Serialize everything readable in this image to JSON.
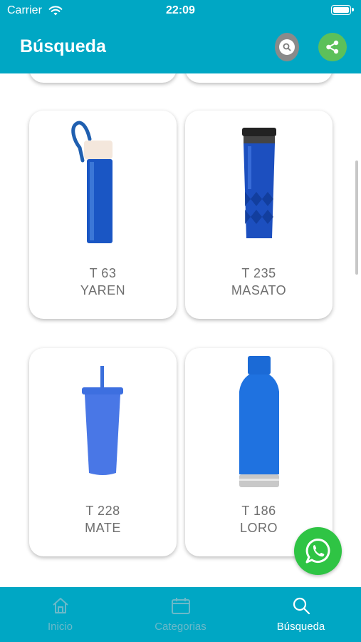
{
  "status_bar": {
    "carrier": "Carrier",
    "time": "22:09"
  },
  "header": {
    "title": "Búsqueda",
    "search_icon": "search-icon",
    "share_icon": "share-icon",
    "background": "#00a7c4"
  },
  "products": [
    {
      "code": "T 63",
      "name": "YAREN",
      "icon": "bottle-icon"
    },
    {
      "code": "T 235",
      "name": "MASATO",
      "icon": "tumbler-icon"
    },
    {
      "code": "T 228",
      "name": "MATE",
      "icon": "straw-cup-icon"
    },
    {
      "code": "T 186",
      "name": "LORO",
      "icon": "thermo-bottle-icon"
    }
  ],
  "fab": {
    "icon": "whatsapp-icon",
    "color": "#2fc444"
  },
  "tabs": [
    {
      "label": "Inicio",
      "icon": "home-icon",
      "active": false
    },
    {
      "label": "Categorias",
      "icon": "calendar-icon",
      "active": false
    },
    {
      "label": "Búsqueda",
      "icon": "search-icon",
      "active": true
    }
  ]
}
